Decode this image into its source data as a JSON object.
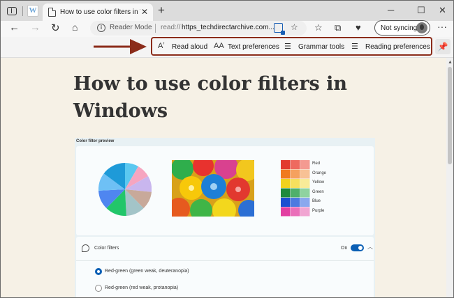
{
  "browser": {
    "tab_title": "How to use color filters in Windows",
    "tab_close": "✕",
    "new_tab": "+",
    "window_controls": {
      "minimize": "─",
      "maximize": "☐",
      "close": "✕"
    },
    "site_logo_letter": "W"
  },
  "address_bar": {
    "mode_label": "Reader Mode",
    "scheme": "read://",
    "url": "https_techdirectarchive.com..."
  },
  "profile": {
    "sync_label": "Not syncing"
  },
  "reader_toolbar": {
    "items": [
      {
        "label": "Read aloud",
        "icon": "read-aloud-icon",
        "glyph": "Aʼ"
      },
      {
        "label": "Text preferences",
        "icon": "text-preferences-icon",
        "glyph": "AA"
      },
      {
        "label": "Grammar tools",
        "icon": "grammar-tools-icon",
        "glyph": "☰"
      },
      {
        "label": "Reading preferences",
        "icon": "reading-preferences-icon",
        "glyph": "☰"
      }
    ],
    "annotation_color": "#8b2c1a"
  },
  "article": {
    "title": "How to use color filters in Windows"
  },
  "figure": {
    "title": "Color filter preview",
    "swatch_labels": [
      "Red",
      "Orange",
      "Yellow",
      "Green",
      "Blue",
      "Purple"
    ],
    "swatch_colors": [
      [
        "#e23b2e",
        "#ee6a5f",
        "#f49a91"
      ],
      [
        "#f07a1e",
        "#f5a15e",
        "#f8c195"
      ],
      [
        "#f1d21c",
        "#f5e05e",
        "#f8eb98"
      ],
      [
        "#1e8a3c",
        "#4fb06a",
        "#8fd3a0"
      ],
      [
        "#1b4fd1",
        "#4b7ae0",
        "#8aa8ee"
      ],
      [
        "#e23fa1",
        "#ea6fb9",
        "#f1a5d2"
      ]
    ],
    "color_filters": {
      "label": "Color filters",
      "state": "On",
      "options": [
        {
          "label": "Red-green (green weak, deuteranopia)",
          "selected": true
        },
        {
          "label": "Red-green (red weak, protanopia)",
          "selected": false
        }
      ]
    }
  }
}
